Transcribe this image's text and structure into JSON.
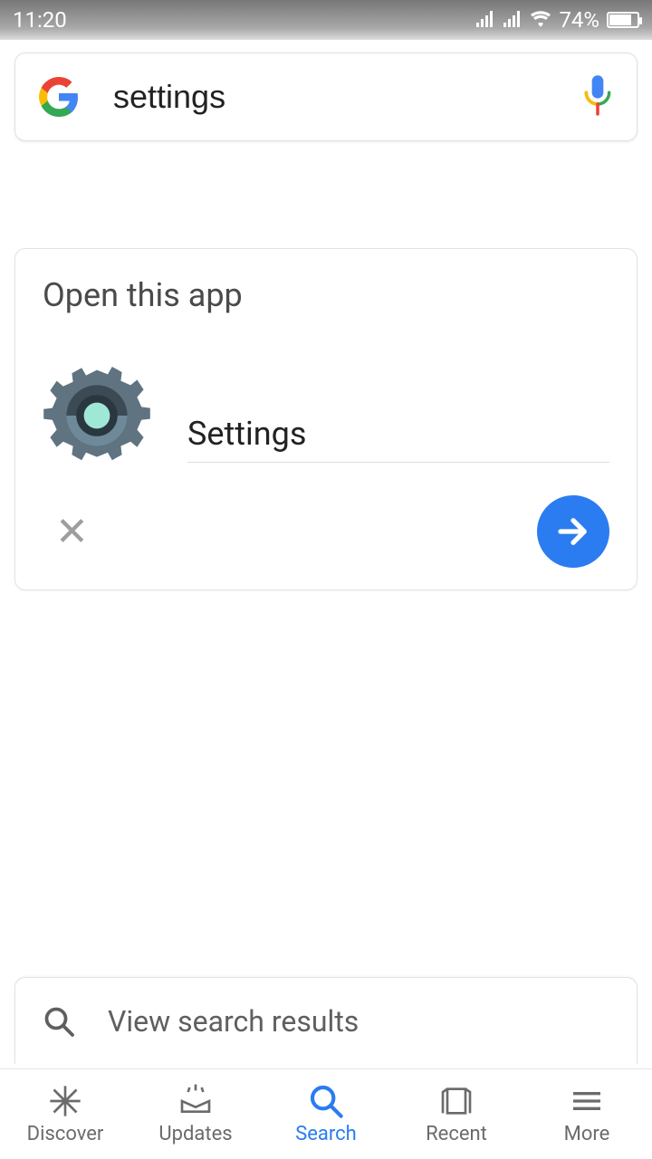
{
  "status": {
    "time": "11:20",
    "battery_pct": "74%"
  },
  "search": {
    "query": "settings"
  },
  "card": {
    "title": "Open this app",
    "app_name": "Settings"
  },
  "results": {
    "label": "View search results"
  },
  "nav": {
    "discover": "Discover",
    "updates": "Updates",
    "search": "Search",
    "recent": "Recent",
    "more": "More"
  }
}
